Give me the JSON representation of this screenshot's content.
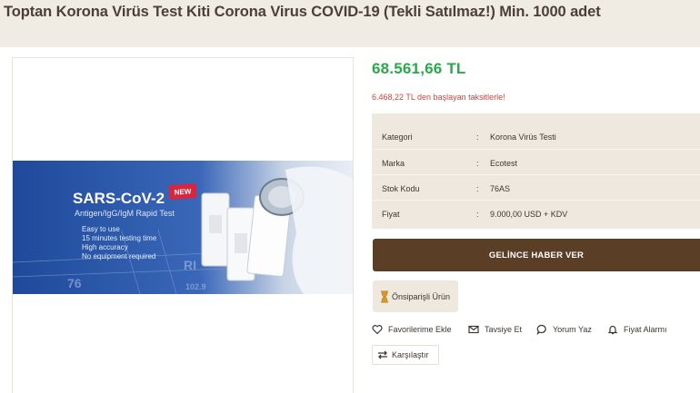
{
  "header": {
    "title": "Toptan Korona Virüs Test Kiti Corona Virus COVID-19 (Tekli Satılmaz!) Min. 1000 adet"
  },
  "product": {
    "price": "68.561,66 TL",
    "installment_note": "6.468,22 TL den başlayan taksitlerle!",
    "specs": [
      {
        "label": "Kategori",
        "sep": ":",
        "value": "Korona Virüs Testi"
      },
      {
        "label": "Marka",
        "sep": ":",
        "value": "Ecotest"
      },
      {
        "label": "Stok Kodu",
        "sep": ":",
        "value": "76AS"
      },
      {
        "label": "Fiyat",
        "sep": ":",
        "value": "9.000,00 USD + KDV"
      }
    ],
    "notify_button": "GELİNCE HABER VER",
    "preorder_badge": "Önsiparişli Ürün",
    "actions": {
      "favorites": "Favorilerime Ekle",
      "recommend": "Tavsiye Et",
      "comment": "Yorum Yaz",
      "price_alert": "Fiyat Alarmı"
    },
    "compare_button": "Karşılaştır"
  },
  "banner": {
    "heading": "SARS-CoV-2",
    "badge": "NEW",
    "subheading": "Antigen/IgG/IgM Rapid Test",
    "bullets": [
      "Easy to use",
      "15 minutes testing time",
      "High accuracy",
      "No equipment required"
    ]
  },
  "colors": {
    "page_bg": "#f1ece3",
    "price_green": "#2aa94a",
    "installment_red": "#d0453a",
    "notify_brown": "#5a3e25",
    "spec_bg": "#eee8df",
    "banner_blue": "#2f57a8"
  }
}
